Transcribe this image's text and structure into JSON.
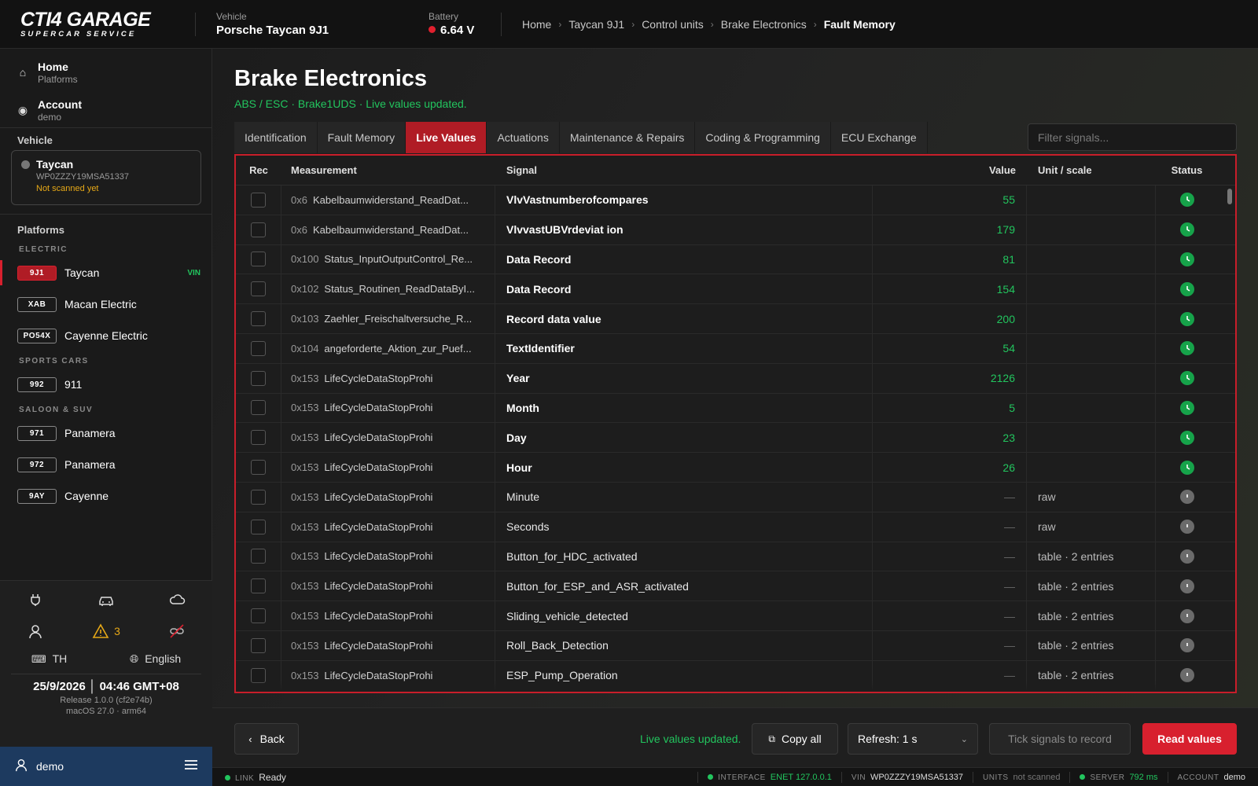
{
  "app": {
    "logo_line1": "CTI4 GARAGE",
    "logo_line2": "SUPERCAR SERVICE"
  },
  "topbar": {
    "vehicle_label": "Vehicle",
    "vehicle_value": "Porsche Taycan 9J1",
    "battery_label": "Battery",
    "battery_value": "6.64 V",
    "breadcrumbs": [
      "Home",
      "Taycan 9J1",
      "Control units",
      "Brake Electronics",
      "Fault Memory"
    ]
  },
  "sidebar": {
    "nav": [
      {
        "title": "Home",
        "sub": "Platforms"
      },
      {
        "title": "Account",
        "sub": "demo"
      }
    ],
    "vehicle_title": "Vehicle",
    "vehicle_card": {
      "name": "Taycan",
      "vin": "WP0ZZZY19MSA51337",
      "status": "Not scanned yet"
    },
    "platforms_title": "Platforms",
    "groups": [
      {
        "name": "ELECTRIC",
        "items": [
          {
            "badge": "9J1",
            "name": "Taycan",
            "tag": "VIN"
          },
          {
            "badge": "XAB",
            "name": "Macan Electric",
            "tag": ""
          },
          {
            "badge": "PO54X",
            "name": "Cayenne Electric",
            "tag": ""
          }
        ]
      },
      {
        "name": "SPORTS CARS",
        "items": [
          {
            "badge": "992",
            "name": "911",
            "tag": ""
          }
        ]
      },
      {
        "name": "SALOON & SUV",
        "items": [
          {
            "badge": "971",
            "name": "Panamera",
            "tag": ""
          },
          {
            "badge": "972",
            "name": "Panamera",
            "tag": ""
          },
          {
            "badge": "9AY",
            "name": "Cayenne",
            "tag": ""
          }
        ]
      }
    ],
    "warning_count": "3",
    "keyboard": "TH",
    "language": "English",
    "datetime": "25/9/2026 │ 04:46 GMT+08",
    "release": "Release 1.0.0 (cf2e74b)",
    "os": "macOS 27.0 · arm64",
    "user": "demo"
  },
  "main": {
    "title": "Brake Electronics",
    "subtitle": "ABS / ESC · Brake1UDS · Live values updated.",
    "tabs": [
      "Identification",
      "Fault Memory",
      "Live Values",
      "Actuations",
      "Maintenance & Repairs",
      "Coding & Programming",
      "ECU Exchange"
    ],
    "active_tab": 2,
    "filter_placeholder": "Filter signals...",
    "columns": {
      "rec": "Rec",
      "measurement": "Measurement",
      "signal": "Signal",
      "value": "Value",
      "unit": "Unit / scale",
      "status": "Status"
    },
    "rows": [
      {
        "addr": "0x6",
        "meas": "Kabelbaumwiderstand_ReadDat...",
        "signal": "VlvVastnumberofcompares",
        "value": "55",
        "unit": "",
        "bold": true,
        "status": "ok"
      },
      {
        "addr": "0x6",
        "meas": "Kabelbaumwiderstand_ReadDat...",
        "signal": "VlvvastUBVrdeviat ion",
        "value": "179",
        "unit": "",
        "bold": true,
        "status": "ok"
      },
      {
        "addr": "0x100",
        "meas": "Status_InputOutputControl_Re...",
        "signal": "Data Record",
        "value": "81",
        "unit": "",
        "bold": true,
        "status": "ok"
      },
      {
        "addr": "0x102",
        "meas": "Status_Routinen_ReadDataByI...",
        "signal": "Data Record",
        "value": "154",
        "unit": "",
        "bold": true,
        "status": "ok"
      },
      {
        "addr": "0x103",
        "meas": "Zaehler_Freischaltversuche_R...",
        "signal": "Record data value",
        "value": "200",
        "unit": "",
        "bold": true,
        "status": "ok"
      },
      {
        "addr": "0x104",
        "meas": "angeforderte_Aktion_zur_Puef...",
        "signal": "TextIdentifier",
        "value": "54",
        "unit": "",
        "bold": true,
        "status": "ok"
      },
      {
        "addr": "0x153",
        "meas": "LifeCycleDataStopProhi",
        "signal": "Year",
        "value": "2126",
        "unit": "",
        "bold": true,
        "status": "ok"
      },
      {
        "addr": "0x153",
        "meas": "LifeCycleDataStopProhi",
        "signal": "Month",
        "value": "5",
        "unit": "",
        "bold": true,
        "status": "ok"
      },
      {
        "addr": "0x153",
        "meas": "LifeCycleDataStopProhi",
        "signal": "Day",
        "value": "23",
        "unit": "",
        "bold": true,
        "status": "ok"
      },
      {
        "addr": "0x153",
        "meas": "LifeCycleDataStopProhi",
        "signal": "Hour",
        "value": "26",
        "unit": "",
        "bold": true,
        "status": "ok"
      },
      {
        "addr": "0x153",
        "meas": "LifeCycleDataStopProhi",
        "signal": "Minute",
        "value": "—",
        "unit": "raw",
        "bold": false,
        "status": "idle"
      },
      {
        "addr": "0x153",
        "meas": "LifeCycleDataStopProhi",
        "signal": "Seconds",
        "value": "—",
        "unit": "raw",
        "bold": false,
        "status": "idle"
      },
      {
        "addr": "0x153",
        "meas": "LifeCycleDataStopProhi",
        "signal": "Button_for_HDC_activated",
        "value": "—",
        "unit": "table · 2 entries",
        "bold": false,
        "status": "idle"
      },
      {
        "addr": "0x153",
        "meas": "LifeCycleDataStopProhi",
        "signal": "Button_for_ESP_and_ASR_activated",
        "value": "—",
        "unit": "table · 2 entries",
        "bold": false,
        "status": "idle"
      },
      {
        "addr": "0x153",
        "meas": "LifeCycleDataStopProhi",
        "signal": "Sliding_vehicle_detected",
        "value": "—",
        "unit": "table · 2 entries",
        "bold": false,
        "status": "idle"
      },
      {
        "addr": "0x153",
        "meas": "LifeCycleDataStopProhi",
        "signal": "Roll_Back_Detection",
        "value": "—",
        "unit": "table · 2 entries",
        "bold": false,
        "status": "idle"
      },
      {
        "addr": "0x153",
        "meas": "LifeCycleDataStopProhi",
        "signal": "ESP_Pump_Operation",
        "value": "—",
        "unit": "table · 2 entries",
        "bold": false,
        "status": "idle"
      }
    ]
  },
  "bottombar": {
    "back": "Back",
    "status": "Live values updated.",
    "copy_all": "Copy all",
    "refresh": "Refresh: 1 s",
    "tick": "Tick signals to record",
    "read": "Read values"
  },
  "footer": {
    "link_label": "LINK",
    "link_value": "Ready",
    "interface_label": "INTERFACE",
    "interface_value": "ENET 127.0.0.1",
    "vin_label": "VIN",
    "vin_value": "WP0ZZZY19MSA51337",
    "units_label": "UNITS",
    "units_value": "not scanned",
    "server_label": "SERVER",
    "server_value": "792 ms",
    "account_label": "ACCOUNT",
    "account_value": "demo"
  },
  "colors": {
    "accent": "#d8202e",
    "ok": "#22c55e",
    "warning": "#e6a817",
    "user_bar": "#1d3a5f"
  }
}
